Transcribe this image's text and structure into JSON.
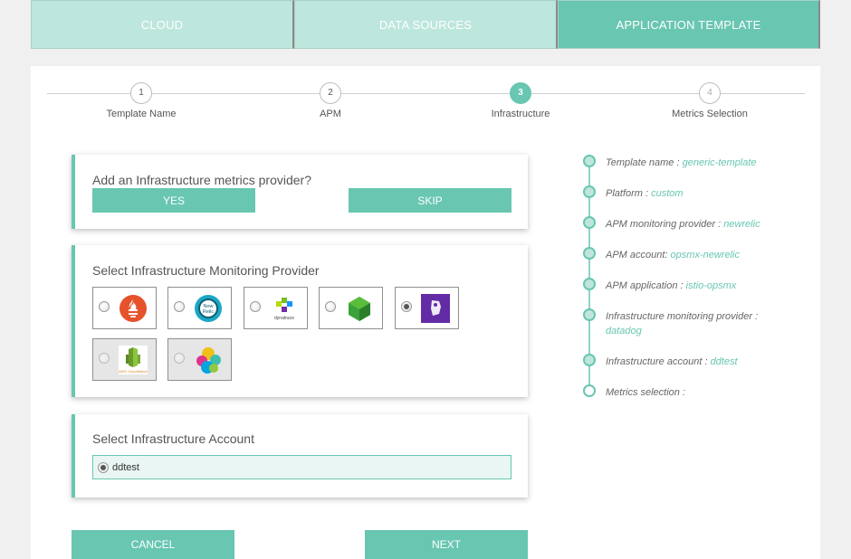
{
  "tabs": [
    {
      "label": "CLOUD"
    },
    {
      "label": "DATA SOURCES"
    },
    {
      "label": "APPLICATION TEMPLATE"
    }
  ],
  "stepper": [
    {
      "num": "1",
      "label": "Template Name",
      "state": "done"
    },
    {
      "num": "2",
      "label": "APM",
      "state": "done"
    },
    {
      "num": "3",
      "label": "Infrastructure",
      "state": "active"
    },
    {
      "num": "4",
      "label": "Metrics Selection",
      "state": "future"
    }
  ],
  "question_card": {
    "title": "Add an Infrastructure metrics provider?",
    "yes_label": "YES",
    "skip_label": "SKIP"
  },
  "provider_card": {
    "title": "Select Infrastructure Monitoring Provider",
    "providers": [
      {
        "name": "prometheus",
        "logo_text": "",
        "selected": false,
        "enabled": true
      },
      {
        "name": "newrelic",
        "logo_text": "New Relic",
        "selected": false,
        "enabled": true
      },
      {
        "name": "dynatrace",
        "logo_text": "dynatrace",
        "selected": false,
        "enabled": true
      },
      {
        "name": "stackdriver",
        "logo_text": "",
        "selected": false,
        "enabled": true
      },
      {
        "name": "datadog",
        "logo_text": "",
        "selected": true,
        "enabled": true
      },
      {
        "name": "aws-cloudwatch",
        "logo_text": "AWS CloudWatch",
        "selected": false,
        "enabled": false
      },
      {
        "name": "elasticsearch",
        "logo_text": "",
        "selected": false,
        "enabled": false
      }
    ]
  },
  "account_card": {
    "title": "Select Infrastructure Account",
    "account": "ddtest"
  },
  "footer": {
    "cancel_label": "CANCEL",
    "next_label": "NEXT"
  },
  "summary": [
    {
      "label": "Template name : ",
      "value": "generic-template"
    },
    {
      "label": "Platform : ",
      "value": "custom"
    },
    {
      "label": "APM monitoring provider : ",
      "value": "newrelic"
    },
    {
      "label": "APM account: ",
      "value": "opsmx-newrelic"
    },
    {
      "label": "APM application : ",
      "value": "istio-opsmx"
    },
    {
      "label": "Infrastructure monitoring provider : ",
      "value": "datadog"
    },
    {
      "label": "Infrastructure account : ",
      "value": "ddtest"
    },
    {
      "label": "Metrics selection : ",
      "value": ""
    }
  ],
  "colors": {
    "accent": "#68c6b1",
    "accent_light": "#bde6dd"
  }
}
